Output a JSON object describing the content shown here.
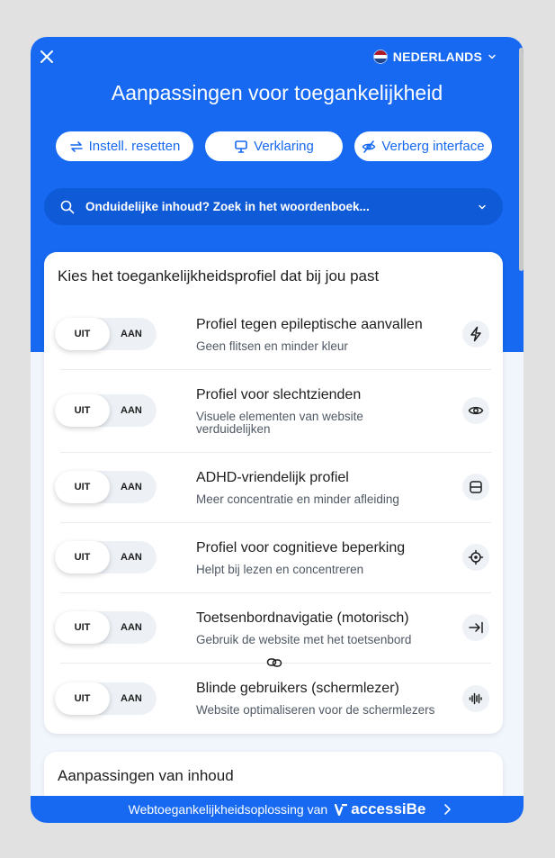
{
  "header": {
    "language": "NEDERLANDS",
    "title": "Aanpassingen voor toegankelijkheid"
  },
  "actions": [
    {
      "label": "Instell. resetten",
      "icon": "reset-arrows-icon"
    },
    {
      "label": "Verklaring",
      "icon": "statement-icon"
    },
    {
      "label": "Verberg interface",
      "icon": "eye-slash-icon"
    }
  ],
  "search": {
    "placeholder": "Onduidelijke inhoud? Zoek in het woordenboek..."
  },
  "profiles_card": {
    "title": "Kies het toegankelijkheidsprofiel dat bij jou past",
    "toggle_off": "UIT",
    "toggle_on": "AAN",
    "profiles": [
      {
        "title": "Profiel tegen epileptische aanvallen",
        "desc": "Geen flitsen en minder kleur",
        "icon": "lightning-icon"
      },
      {
        "title": "Profiel voor slechtzienden",
        "desc": "Visuele elementen van website verduidelijken",
        "icon": "eye-icon"
      },
      {
        "title": "ADHD-vriendelijk profiel",
        "desc": "Meer concentratie en minder afleiding",
        "icon": "focus-frame-icon"
      },
      {
        "title": "Profiel voor cognitieve beperking",
        "desc": "Helpt bij lezen en concentreren",
        "icon": "target-icon"
      },
      {
        "title": "Toetsenbordnavigatie (motorisch)",
        "desc": "Gebruik de website met het toetsenbord",
        "icon": "arrow-to-bar-icon"
      },
      {
        "title": "Blinde gebruikers (schermlezer)",
        "desc": "Website optimaliseren voor de schermlezers",
        "icon": "audio-wave-icon"
      }
    ]
  },
  "content_card": {
    "title": "Aanpassingen van inhoud"
  },
  "footer": {
    "text": "Webtoegankelijkheidsoplossing van",
    "brand": "accessiBe"
  },
  "colors": {
    "primary": "#1669f0",
    "search_bg": "#0f5ad6",
    "panel_bg": "#f1f5fc"
  }
}
